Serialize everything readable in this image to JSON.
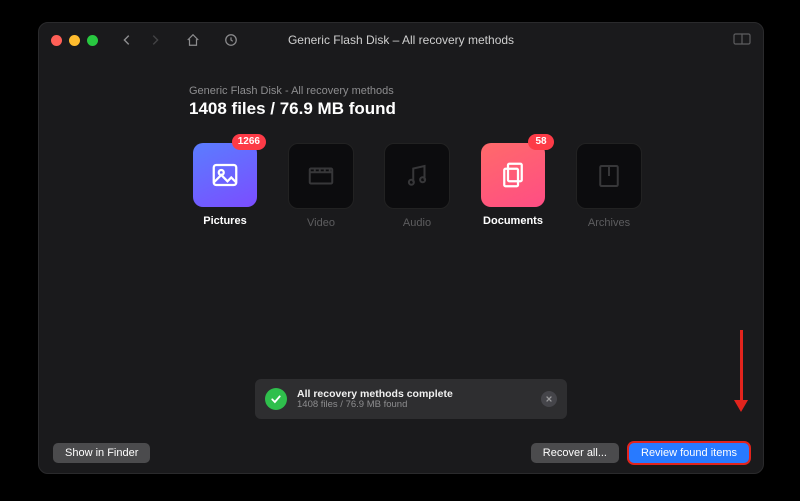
{
  "window": {
    "title": "Generic Flash Disk – All recovery methods"
  },
  "header": {
    "subtitle": "Generic Flash Disk - All recovery methods",
    "headline": "1408 files / 76.9 MB found"
  },
  "categories": [
    {
      "key": "pictures",
      "label": "Pictures",
      "badge": "1266",
      "active": true
    },
    {
      "key": "video",
      "label": "Video",
      "badge": null,
      "active": false
    },
    {
      "key": "audio",
      "label": "Audio",
      "badge": null,
      "active": false
    },
    {
      "key": "documents",
      "label": "Documents",
      "badge": "58",
      "active": true
    },
    {
      "key": "archives",
      "label": "Archives",
      "badge": null,
      "active": false
    }
  ],
  "toast": {
    "title": "All recovery methods complete",
    "subtitle": "1408 files / 76.9 MB found"
  },
  "footer": {
    "show_in_finder": "Show in Finder",
    "recover_all": "Recover all...",
    "review": "Review found items"
  },
  "colors": {
    "highlight": "#e2241d",
    "badge": "#fd3b47",
    "primary_button": "#287aff"
  }
}
